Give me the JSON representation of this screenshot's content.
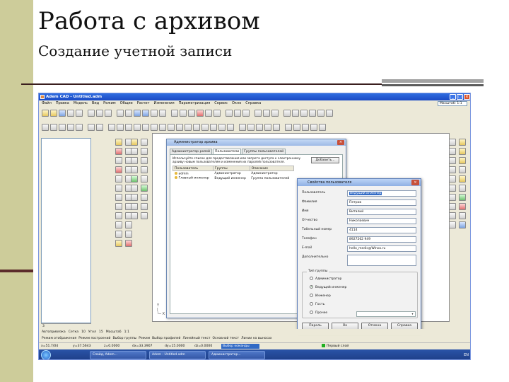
{
  "slide": {
    "title": "Работа с архивом",
    "subtitle": "Создание учетной записи"
  },
  "window": {
    "title": "Adem CAD - Untitled.adm",
    "zoom_value": "Масштаб: 1:1"
  },
  "menu": [
    "Файл",
    "Правка",
    "Модель",
    "Вид",
    "Режим",
    "Общие",
    "Расчет",
    "Изменения",
    "Параметризация",
    "Сервис",
    "Окно",
    "Справка"
  ],
  "admin_dialog": {
    "title": "Администратор архива",
    "tabs": [
      "Администратор ролей",
      "Пользователи",
      "Группы пользователей"
    ],
    "description": "Используйте список для предоставления или запрета доступа к электронному архиву новым пользователям и изменения их паролей пользователя.",
    "add_button": "Добавить...",
    "columns": [
      "Пользователь",
      "Группы",
      "Описание"
    ],
    "rows": [
      {
        "user": "admin",
        "group": "Администратор",
        "desc": "Администратор"
      },
      {
        "user": "Главный инженер",
        "group": "Ведущий инженер",
        "desc": "Группа пользователей"
      }
    ]
  },
  "user_dialog": {
    "title": "Свойства пользователя",
    "fields": [
      {
        "label": "Пользователь",
        "value": "Ведущий инженер"
      },
      {
        "label": "Фамилия",
        "value": "Петров"
      },
      {
        "label": "Имя",
        "value": "Виталий"
      },
      {
        "label": "Отчество",
        "value": "Николаевич"
      },
      {
        "label": "Табельный номер",
        "value": "4114"
      },
      {
        "label": "Телефон",
        "value": "8927262 949"
      },
      {
        "label": "E-mail",
        "value": "hello_medic@Wlnox.ru"
      },
      {
        "label": "Дополнительно",
        "value": ""
      }
    ],
    "group_label": "Тип группы",
    "radios": [
      {
        "label": "Администратор",
        "selected": false
      },
      {
        "label": "Ведущий инженер",
        "selected": true
      },
      {
        "label": "Инженер",
        "selected": false
      },
      {
        "label": "Гость",
        "selected": false
      },
      {
        "label": "Прочее",
        "selected": false
      }
    ],
    "buttons": [
      "Пароль",
      "Ок",
      "Отмена",
      "Справка"
    ]
  },
  "bottom_bar": {
    "items": [
      "Автопривязка",
      "Сетка",
      "10",
      "Угол",
      "15",
      "Масштаб",
      "1:1"
    ]
  },
  "bottom_bar2": {
    "items": [
      "Режим отображения",
      "Режим построений",
      "Выбор группы",
      "Режим",
      "Выбор профилей",
      "Линейный текст",
      "Основной текст",
      "Линии на выносах"
    ]
  },
  "status": {
    "x": "x=51.7/04",
    "y": "y=37.5643",
    "z": "z=0.0000",
    "dx": "dx=33.3907",
    "dy": "dy=15.0000",
    "dz": "dz=0.0000",
    "selection": "Выбор команды",
    "layer": "Первый слой"
  },
  "taskbar": {
    "tasks": [
      "Слайд, Adem...",
      "Adem - Untitled.adm",
      "Администратор..."
    ],
    "lang": "EN"
  },
  "panel": {
    "tab": "3"
  }
}
